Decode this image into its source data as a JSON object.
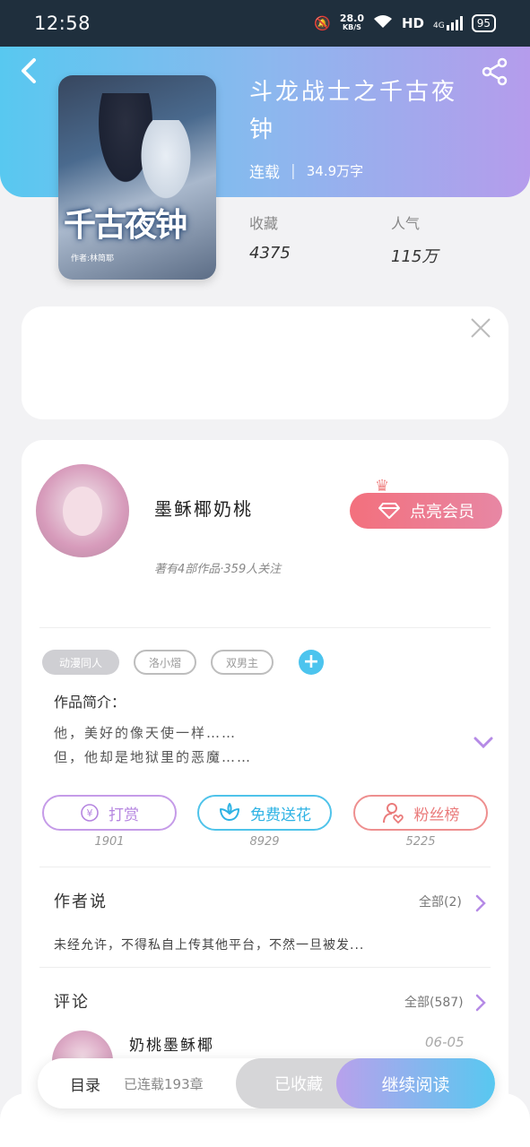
{
  "status_bar": {
    "time": "12:58",
    "net_speed": "28.0",
    "net_unit": "KB/S",
    "hd": "HD",
    "signal": "4G",
    "battery": "95"
  },
  "book": {
    "title": "斗龙战士之千古夜钟",
    "status": "连载",
    "divider": "|",
    "word_count": "34.9万字",
    "cover_title": "千古夜钟",
    "cover_author": "作者:林简耶",
    "stats": [
      {
        "label": "收藏",
        "value": "4375"
      },
      {
        "label": "人气",
        "value": "115万"
      }
    ]
  },
  "author": {
    "name": "墨稣椰奶桃",
    "vip_label": "点亮会员",
    "stats_text": "著有4部作品·359人关注"
  },
  "tags": [
    "动漫同人",
    "洛小熠",
    "双男主"
  ],
  "intro": {
    "title": "作品简介：",
    "lines": [
      "他，美好的像天使一样……",
      "但，他却是地狱里的恶魔……"
    ]
  },
  "actions": [
    {
      "label": "打赏",
      "count": "1901",
      "icon": "yen-coin-icon"
    },
    {
      "label": "免费送花",
      "count": "8929",
      "icon": "flower-icon"
    },
    {
      "label": "粉丝榜",
      "count": "5225",
      "icon": "user-heart-icon"
    }
  ],
  "author_says": {
    "title": "作者说",
    "all_label": "全部(2)",
    "text": "未经允许，不得私自上传其他平台，不然一旦被发..."
  },
  "comments": {
    "title": "评论",
    "all_label": "全部(587)",
    "first": {
      "user": "奶桃墨稣椰",
      "date": "06-05"
    }
  },
  "bottom_bar": {
    "toc_label": "目录",
    "chapters": "已连载193章",
    "collected_label": "已收藏",
    "continue_label": "继续阅读"
  },
  "colors": {
    "accent_blue": "#58c8f0",
    "accent_purple": "#b59cec",
    "vip_pink": "#f3707d"
  }
}
